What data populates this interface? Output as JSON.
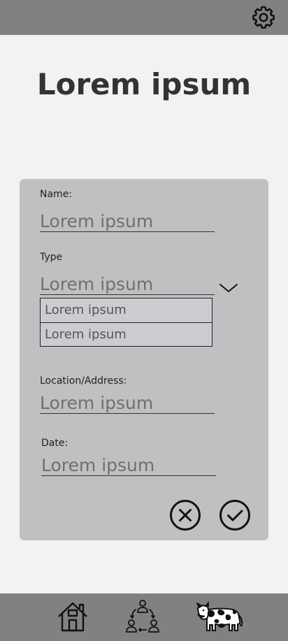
{
  "header": {
    "settings_icon": "gear-icon"
  },
  "page": {
    "title": "Lorem ipsum"
  },
  "form": {
    "name_label": "Name:",
    "name_value": "Lorem ipsum",
    "type_label": "Type",
    "type_value": "Lorem ipsum",
    "type_options": [
      "Lorem ipsum",
      "Lorem ipsum"
    ],
    "location_label": "Location/Address:",
    "location_value": "Lorem ipsum",
    "date_label": "Date:",
    "date_value": "Lorem ipsum",
    "cancel_icon": "close-circle-icon",
    "confirm_icon": "check-circle-icon"
  },
  "bottom_nav": {
    "items": [
      "home-icon",
      "people-exchange-icon",
      "cow-icon"
    ]
  },
  "colors": {
    "bars": "#808183",
    "card": "#bfc0c2",
    "background": "#f2f2f2",
    "options": "#cbcccf"
  }
}
